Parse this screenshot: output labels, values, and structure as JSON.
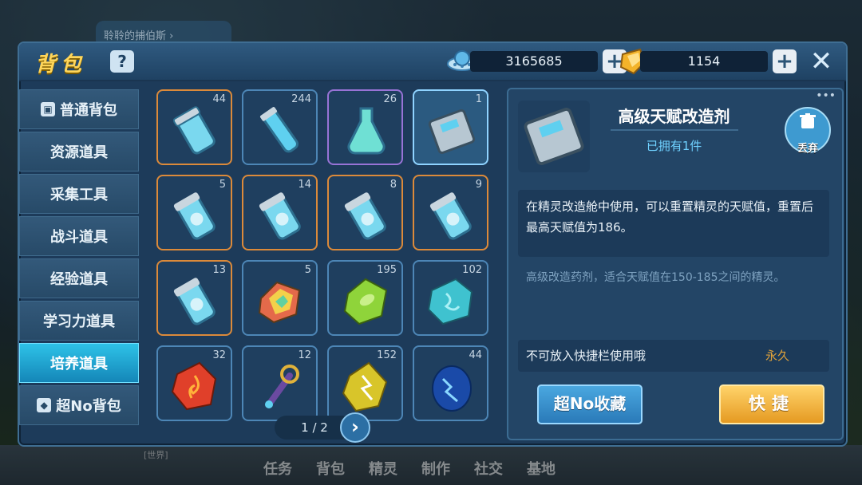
{
  "background": {
    "tab_label": "聆聆的捕伯斯 ›",
    "nav": [
      "任务",
      "背包",
      "精灵",
      "制作",
      "社交",
      "基地"
    ],
    "label": "[世界]"
  },
  "header": {
    "title": "背包",
    "help": "?",
    "coins": "3165685",
    "gems": "1154",
    "plus": "+",
    "close": "✕"
  },
  "sidebar": {
    "items": [
      {
        "label": "普通背包",
        "icon": "backpack-icon",
        "active": false
      },
      {
        "label": "资源道具",
        "active": false
      },
      {
        "label": "采集工具",
        "active": false
      },
      {
        "label": "战斗道具",
        "active": false
      },
      {
        "label": "经验道具",
        "active": false
      },
      {
        "label": "学习力道具",
        "active": false
      },
      {
        "label": "培养道具",
        "active": true
      },
      {
        "label": "超No背包",
        "icon": "shield-icon",
        "active": false
      }
    ]
  },
  "grid": {
    "items": [
      {
        "qty": "44",
        "icon": "potion-jar-cyan-icon",
        "border": "orange"
      },
      {
        "qty": "244",
        "icon": "potion-tube-icon",
        "border": "blue"
      },
      {
        "qty": "26",
        "icon": "potion-flask-icon",
        "border": "purple"
      },
      {
        "qty": "1",
        "icon": "device-capsule-icon",
        "border": "selected"
      },
      {
        "qty": "5",
        "icon": "potion-jar-leaf-icon",
        "border": "orange"
      },
      {
        "qty": "14",
        "icon": "potion-jar-shield-icon",
        "border": "orange"
      },
      {
        "qty": "8",
        "icon": "potion-jar-fire-icon",
        "border": "orange"
      },
      {
        "qty": "9",
        "icon": "potion-jar-star-icon",
        "border": "orange"
      },
      {
        "qty": "13",
        "icon": "potion-jar-swirl-icon",
        "border": "orange"
      },
      {
        "qty": "5",
        "icon": "rainbow-crystal-icon",
        "border": "blue"
      },
      {
        "qty": "195",
        "icon": "green-leaf-stone-icon",
        "border": "blue"
      },
      {
        "qty": "102",
        "icon": "cyan-rune-stone-icon",
        "border": "blue"
      },
      {
        "qty": "32",
        "icon": "fire-stone-icon",
        "border": "blue"
      },
      {
        "qty": "12",
        "icon": "magic-wand-icon",
        "border": "blue"
      },
      {
        "qty": "152",
        "icon": "thunder-crystal-icon",
        "border": "blue"
      },
      {
        "qty": "44",
        "icon": "blue-lightning-stone-icon",
        "border": "blue"
      }
    ]
  },
  "pager": {
    "text": "1 / 2",
    "next": "›"
  },
  "detail": {
    "name": "高级天赋改造剂",
    "owned": "已拥有1件",
    "discard": "丢弃",
    "description": "在精灵改造舱中使用，可以重置精灵的天赋值，重置后最高天赋值为186。",
    "note": "高级改造药剂，适合天赋值在150-185之间的精灵。",
    "usage": "不可放入快捷栏使用哦",
    "duration": "永久",
    "collect_button": "超No收藏",
    "quick_button": "快捷"
  },
  "colors": {
    "panel": "#1d3b5a",
    "active_tab": "#1486b8",
    "gold": "#ffd65a",
    "border_orange": "#dc8a3a",
    "border_purple": "#9873d6"
  }
}
